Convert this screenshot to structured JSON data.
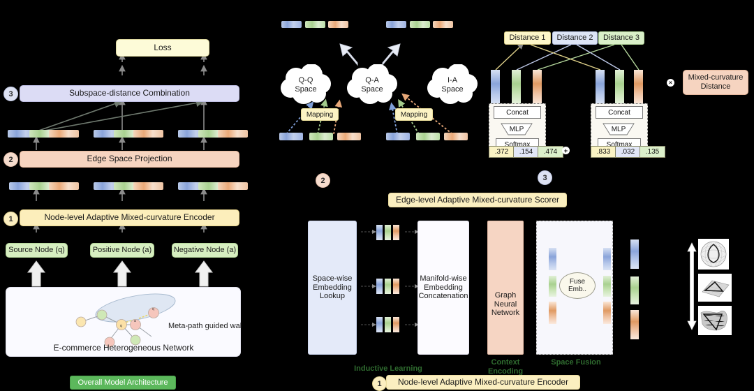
{
  "left_panel": {
    "loss_label": "Loss",
    "step3_badge": "3",
    "subspace_label": "Subspace-distance Combination",
    "step2_badge": "2",
    "edge_space_label": "Edge Space Projection",
    "step1_badge": "1",
    "encoder_label": "Node-level Adaptive Mixed-curvature Encoder",
    "nodes": [
      {
        "label": "Source Node (q)"
      },
      {
        "label": "Positive Node (a)"
      },
      {
        "label": "Negative Node (a)"
      }
    ],
    "network_box": {
      "title": "E-commerce Heterogeneous  Network",
      "walk_label": "Meta-path guided walk",
      "walk_nodes": [
        "q",
        "a",
        "q"
      ]
    },
    "caption": "Overall Model Architecture"
  },
  "middle_panel": {
    "spaces": [
      {
        "name": "Q-Q\nSpace",
        "line1": "Q-Q",
        "line2": "Space"
      },
      {
        "name": "Q-A\nSpace",
        "line1": "Q-A",
        "line2": "Space"
      },
      {
        "name": "I-A\nSpace",
        "line1": "I-A",
        "line2": "Space"
      }
    ],
    "mapping_label_left": "Mapping",
    "mapping_label_right": "Mapping",
    "step2_badge": "2",
    "scorer_caption": "Edge-level Adaptive Mixed-curvature Scorer",
    "step3_badge": "3"
  },
  "scorer_panel": {
    "distances": [
      {
        "label": "Distance 1",
        "color": "#fdf6c8"
      },
      {
        "label": "Distance 2",
        "color": "#dde4f5"
      },
      {
        "label": "Distance 3",
        "color": "#d9efc8"
      }
    ],
    "blocks": {
      "concat": "Concat",
      "mlp": "MLP",
      "softmax": "Softmax"
    },
    "scores_left": [
      ".372",
      ".154",
      ".474"
    ],
    "scores_right": [
      ".833",
      ".032",
      ".135"
    ],
    "plus_operator": "+",
    "times_operator": "×",
    "mixed_curvature_distance": "Mixed-curvature\nDistance",
    "mixed_curvature_distance_l1": "Mixed-curvature",
    "mixed_curvature_distance_l2": "Distance"
  },
  "encoder_panel": {
    "columns": [
      {
        "title_l1": "Space-wise",
        "title_l2": "Embedding",
        "title_l3": "Lookup"
      },
      {
        "title_l1": "Manifold-wise",
        "title_l2": "Embedding",
        "title_l3": "Concatenation"
      },
      {
        "title_l1": "Graph",
        "title_l2": "Neural",
        "title_l3": "Network"
      },
      {
        "title_l1": "Fuse",
        "title_l2": "Emb.."
      }
    ],
    "captions": [
      "Inductive Learning",
      "Context\nEncoding",
      "Space Fusion"
    ],
    "caption_context_l1": "Context",
    "caption_context_l2": "Encoding",
    "caption_inductive": "Inductive Learning",
    "caption_fusion": "Space Fusion",
    "step1_badge": "1",
    "bottom_caption": "Node-level Adaptive Mixed-curvature Encoder",
    "manifolds": [
      "spherical-manifold",
      "euclidean-manifold",
      "hyperbolic-manifold"
    ]
  },
  "colors": {
    "blue": "#8aa4da",
    "green": "#a9d190",
    "orange": "#eaa978",
    "accent_green": "#5cb85c",
    "gold": "#fceebb",
    "peach": "#f6d4c0",
    "lilac": "#dcdcf5"
  }
}
